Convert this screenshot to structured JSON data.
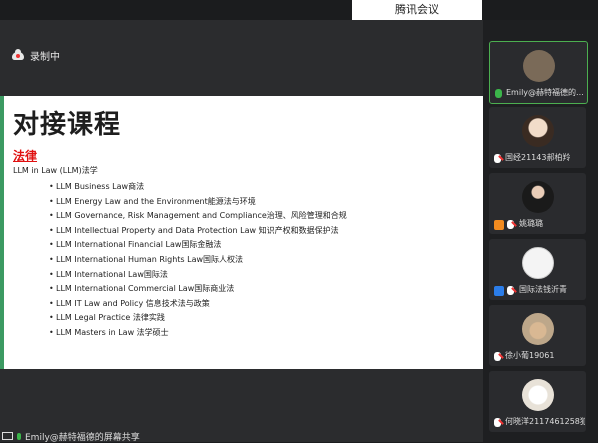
{
  "app": {
    "title": "腾讯会议"
  },
  "recording": {
    "label": "录制中"
  },
  "slide": {
    "title": "对接课程",
    "subtitle": "法律",
    "intro": "LLM in Law (LLM)法学",
    "bullets": [
      "LLM Business Law商法",
      "LLM Energy Law and the Environment能源法与环境",
      "LLM Governance, Risk Management and Compliance治理、风险管理和合规",
      "LLM Intellectual Property and Data Protection Law 知识产权和数据保护法",
      "LLM International Financial Law国际金融法",
      "LLM International Human Rights Law国际人权法",
      "LLM International Law国际法",
      "LLM International Commercial Law国际商业法",
      "LLM IT Law and Policy 信息技术法与政策",
      "LLM Legal Practice 法律实践",
      "LLM Masters in Law 法学硕士"
    ]
  },
  "share_bar": {
    "label": "Emily@赫特福德的屏幕共享"
  },
  "participants": [
    {
      "name": "Emily@赫特福德的...",
      "mic": "on",
      "avatar_color": "#7a6a58"
    },
    {
      "name": "国经21143郝柏羚",
      "mic": "muted",
      "avatar_color": "#e7cbb4"
    },
    {
      "name": "姚璐璐",
      "mic": "muted",
      "role": "orange",
      "avatar_color": "#222222"
    },
    {
      "name": "国际法钱沂青",
      "mic": "muted",
      "role": "blue",
      "avatar_color": "#f4f4f4"
    },
    {
      "name": "徐小葡19061",
      "mic": "muted",
      "avatar_color": "#b9a58c"
    },
    {
      "name": "何晓洋2117461258犯...",
      "mic": "muted",
      "avatar_color": "#f2eee8"
    }
  ],
  "colors": {
    "accent": "#3c9a62",
    "subtitle_red": "#e01010",
    "mic_on": "#3bb54a"
  }
}
